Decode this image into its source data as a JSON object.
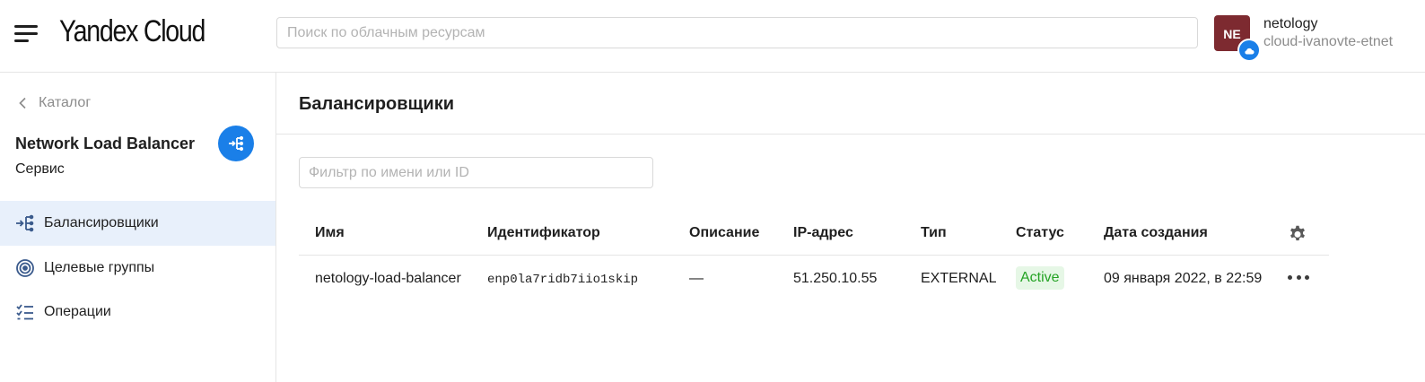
{
  "header": {
    "logo": "Yandex Cloud",
    "search_placeholder": "Поиск по облачным ресурсам",
    "avatar_initials": "NE",
    "account_name": "netology",
    "account_cloud": "cloud-ivanovte-etnet"
  },
  "sidebar": {
    "back_label": "Каталог",
    "service_title": "Network Load Balancer",
    "service_subtitle": "Сервис",
    "items": [
      {
        "label": "Балансировщики",
        "icon": "load-balancer-icon",
        "active": true
      },
      {
        "label": "Целевые группы",
        "icon": "target-icon",
        "active": false
      },
      {
        "label": "Операции",
        "icon": "list-check-icon",
        "active": false
      }
    ]
  },
  "main": {
    "title": "Балансировщики",
    "filter_placeholder": "Фильтр по имени или ID",
    "columns": [
      "Имя",
      "Идентификатор",
      "Описание",
      "IP-адрес",
      "Тип",
      "Статус",
      "Дата создания"
    ],
    "rows": [
      {
        "name": "netology-load-balancer",
        "id": "enp0la7ridb7iio1skip",
        "description": "—",
        "ip": "51.250.10.55",
        "type": "EXTERNAL",
        "status": "Active",
        "created": "09 января 2022, в 22:59"
      }
    ]
  },
  "colors": {
    "accent": "#1a7fe8",
    "avatar_bg": "#7d2a30",
    "active_nav_bg": "#e8f0fb",
    "status_active_text": "#24a324",
    "status_active_bg": "#e6f7e6"
  }
}
